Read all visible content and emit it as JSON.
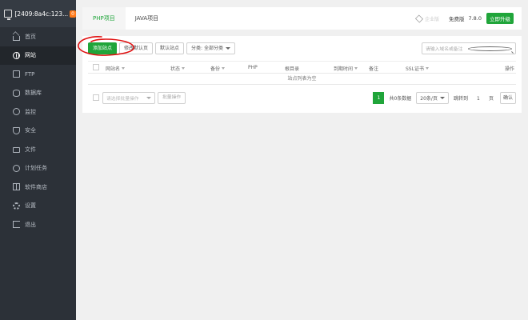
{
  "sidebar": {
    "server_title": "[2409:8a4c:123...",
    "badge": "0",
    "items": [
      {
        "label": "首页",
        "icon": "home-icon"
      },
      {
        "label": "网站",
        "icon": "globe-icon",
        "active": true
      },
      {
        "label": "FTP",
        "icon": "ftp-icon"
      },
      {
        "label": "数据库",
        "icon": "database-icon"
      },
      {
        "label": "监控",
        "icon": "monitor-icon"
      },
      {
        "label": "安全",
        "icon": "shield-icon"
      },
      {
        "label": "文件",
        "icon": "folder-icon"
      },
      {
        "label": "计划任务",
        "icon": "clock-icon"
      },
      {
        "label": "软件商店",
        "icon": "grid-icon"
      },
      {
        "label": "设置",
        "icon": "gear-icon"
      },
      {
        "label": "退出",
        "icon": "exit-icon"
      }
    ]
  },
  "tabs": {
    "php": "PHP项目",
    "java": "JAVA项目"
  },
  "header": {
    "gem_label": "企业版",
    "edition": "免费版",
    "version": "7.8.0",
    "upgrade": "立即升级"
  },
  "toolbar": {
    "add_site": "添加站点",
    "default_page": "修改默认页",
    "default_site": "默认站点",
    "category": "分类: 全部分类",
    "search_placeholder": "请输入域名或备注"
  },
  "table": {
    "headers": {
      "name": "网站名",
      "status": "状态",
      "backup": "备份",
      "php": "PHP",
      "root": "根目录",
      "expire": "到期时间",
      "remark": "备注",
      "ssl": "SSL证书",
      "ops": "操作"
    },
    "empty_text": "站点列表为空"
  },
  "footer": {
    "batch_placeholder": "请选择批量操作",
    "batch_button": "批量操作",
    "current_page": "1",
    "total": "共0条数据",
    "per_page": "20条/页",
    "goto_prefix": "跳转到",
    "goto_value": "1",
    "goto_suffix": "页",
    "confirm": "确认"
  },
  "colors": {
    "accent": "#20a53a",
    "sidebar_bg": "#2c3138",
    "annotation": "#e01010"
  }
}
